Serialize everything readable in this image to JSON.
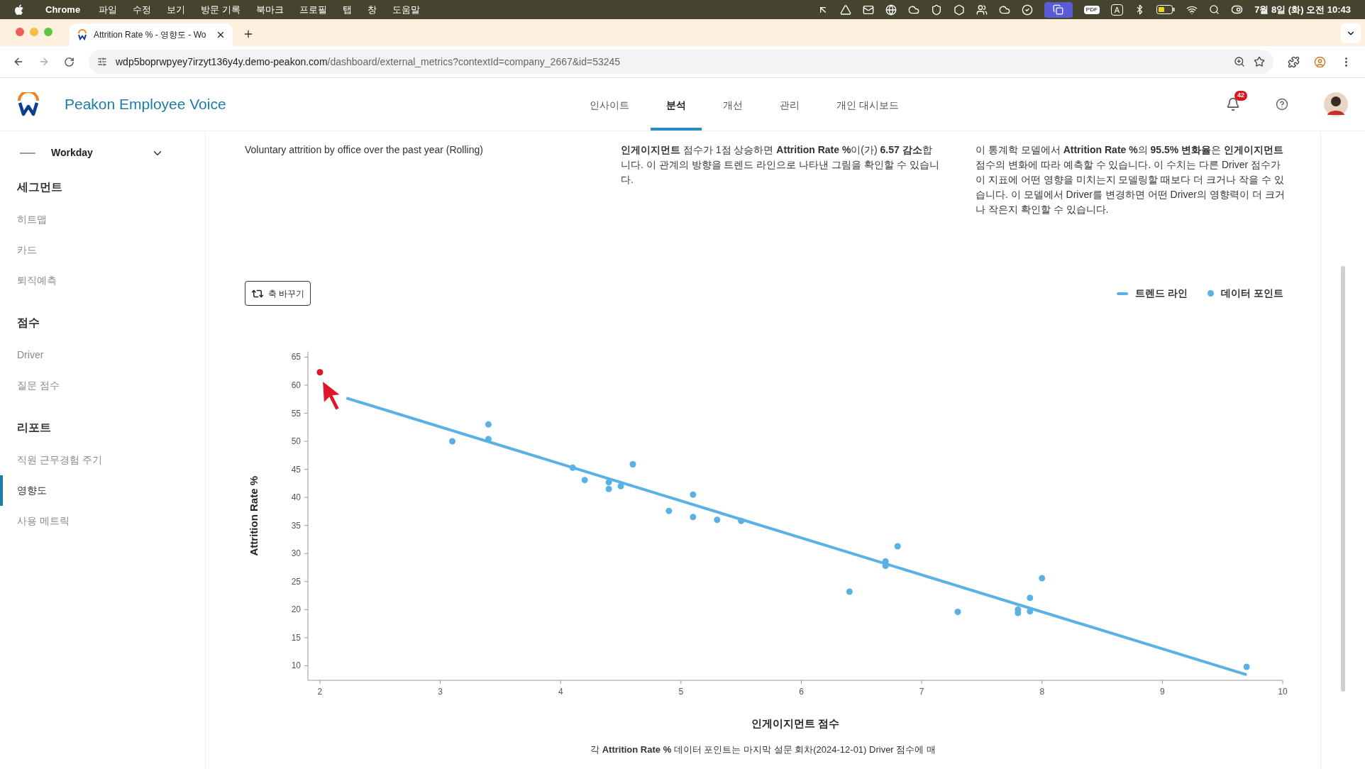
{
  "menu_bar": {
    "app": "Chrome",
    "menus": [
      "파일",
      "수정",
      "보기",
      "방문 기록",
      "북마크",
      "프로필",
      "탭",
      "창",
      "도움말"
    ],
    "pdf_label": "PDF",
    "input_label": "A",
    "clock": "7월 8일 (화) 오전 10:43"
  },
  "browser": {
    "tabs": [
      {
        "title": "Attrition Rate % - 영향도 - Wo",
        "selected": true
      }
    ],
    "url_host": "wdp5boprwpyey7irzyt136y4y.demo-peakon.com",
    "url_path": "/dashboard/external_metrics?contextId=company_2667&id=53245"
  },
  "header": {
    "title": "Peakon Employee Voice",
    "nav": [
      {
        "label": "인사이트",
        "selected": false
      },
      {
        "label": "분석",
        "selected": true
      },
      {
        "label": "개선",
        "selected": false
      },
      {
        "label": "관리",
        "selected": false
      },
      {
        "label": "개인 대시보드",
        "selected": false
      }
    ],
    "notification_count": "42"
  },
  "sidebar": {
    "account": "Workday",
    "sections": [
      {
        "heading": "세그먼트",
        "items": [
          {
            "label": "히트맵",
            "selected": false
          },
          {
            "label": "카드",
            "selected": false
          },
          {
            "label": "퇴직예측",
            "selected": false
          }
        ]
      },
      {
        "heading": "점수",
        "items": [
          {
            "label": "Driver",
            "selected": false
          },
          {
            "label": "질문 점수",
            "selected": false
          }
        ]
      },
      {
        "heading": "리포트",
        "items": [
          {
            "label": "직원 근무경험 주기",
            "selected": false
          },
          {
            "label": "영향도",
            "selected": true
          },
          {
            "label": "사용 메트릭",
            "selected": false
          }
        ]
      }
    ]
  },
  "content": {
    "description": "Voluntary attrition by office over the past year (Rolling)",
    "paragraphs": [
      "**인게이지먼트** 점수가 1점 상승하면 **Attrition Rate %**이(가) **6.57 감소**합니다. 이 관계의 방향을 트렌드 라인으로 나타낸 그림을 확인할 수 있습니다.",
      "이 통계학 모델에서 **Attrition Rate %**의 **95.5% 변화율**은 **인게이지먼트** 점수의 변화에 따라 예측할 수 있습니다. 이 수치는 다른 Driver 점수가 이 지표에 어떤 영향을 미치는지 모델링할 때보다 더 크거나 작을 수 있습니다. 이 모델에서 Driver를 변경하면 어떤 Driver의 영향력이 더 크거나 작은지 확인할 수 있습니다."
    ],
    "swap_axes_button": "축 바꾸기",
    "chart_data": {
      "type": "scatter",
      "xlabel": "인게이지먼트 점수",
      "ylabel": "Attrition Rate %",
      "xlim": [
        1.9,
        10
      ],
      "ylim": [
        7.4,
        66
      ],
      "xticks": [
        2,
        3,
        4,
        5,
        6,
        7,
        8,
        9,
        10
      ],
      "yticks": [
        10,
        15,
        20,
        25,
        30,
        35,
        40,
        45,
        50,
        55,
        60,
        65
      ],
      "series": [
        {
          "name": "데이터 포인트",
          "type": "scatter",
          "color": "#5ab1e6",
          "x": [
            3.1,
            3.4,
            3.4,
            4.1,
            4.2,
            4.4,
            4.4,
            4.5,
            4.6,
            4.9,
            5.1,
            5.1,
            5.3,
            5.5,
            6.4,
            6.7,
            6.7,
            6.8,
            7.3,
            7.8,
            7.8,
            7.9,
            7.9,
            8.0,
            9.7
          ],
          "values": [
            50,
            53,
            50.4,
            45.3,
            43.1,
            42.7,
            41.5,
            42,
            45.9,
            37.6,
            40.5,
            36.5,
            36,
            35.8,
            23.2,
            28.6,
            27.8,
            31.3,
            19.6,
            20,
            19.4,
            22.1,
            19.7,
            25.6,
            9.8
          ]
        },
        {
          "name": "트렌드 라인",
          "type": "line",
          "color": "#5ab1e6",
          "x": [
            2.22,
            9.7
          ],
          "values": [
            57.7,
            8.4
          ]
        },
        {
          "type": "scatter",
          "color": "#e0142a",
          "x": [
            2.0
          ],
          "values": [
            62.3
          ]
        }
      ]
    },
    "footnote": "각 **Attrition Rate %** 데이터 포인트는 마지막 설문 회차(2024-12-01) Driver 점수에 매"
  }
}
